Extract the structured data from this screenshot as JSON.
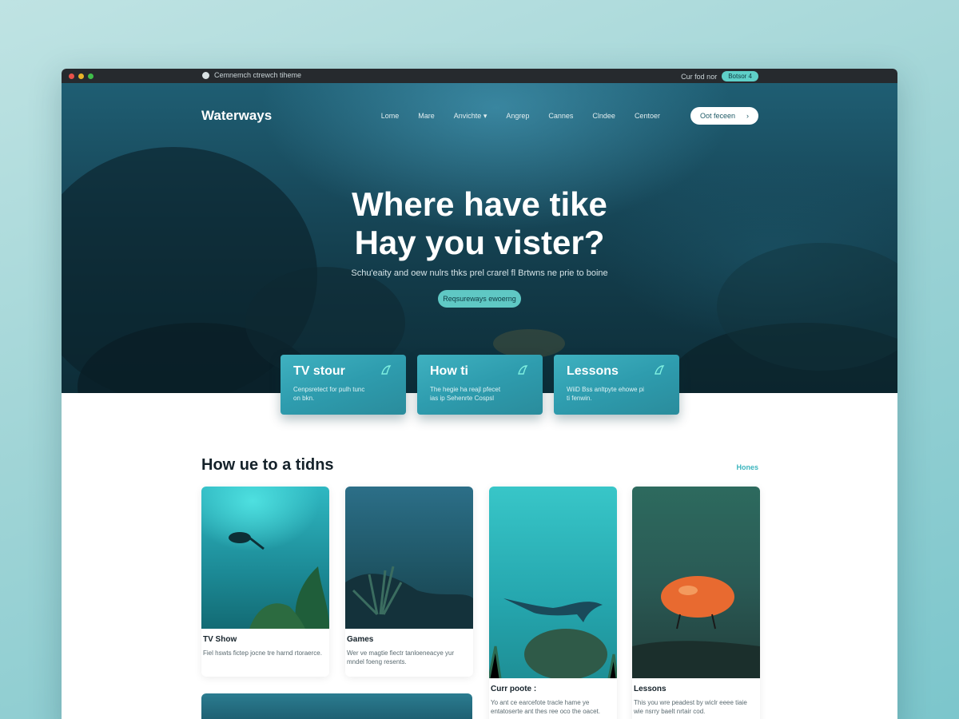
{
  "browser": {
    "url": "Cemnemch ctrewch tiheme",
    "right_link": "Cur fod nor",
    "right_button": "Botsor 4"
  },
  "nav": {
    "logo": "Waterways",
    "links": [
      "Lome",
      "Mare",
      "Anvichte ▾",
      "Angrep",
      "Cannes",
      "Clndee",
      "Centoer"
    ],
    "cta": "Oot feceen",
    "cta_icon": "›"
  },
  "hero": {
    "title_line1": "Where have tike",
    "title_line2": "Hay you vister?",
    "subtitle": "Schu'eaity and oew nulrs thks prel crarel fl Brtwns ne prie to boine",
    "button": "Reqsureways ewoerng"
  },
  "features": [
    {
      "title": "TV stour",
      "desc": "Cenpsretect for pulh tunc on bkn.",
      "icon": "fin-icon"
    },
    {
      "title": "How ti",
      "desc": "The hegie ha reajl pfecet ias ip Sehenrte Cospsl",
      "icon": "fin-icon"
    },
    {
      "title": "Lessons",
      "desc": "WiiD Bss anltpyte ehowe pi ti fenwin.",
      "icon": "fin-icon"
    }
  ],
  "section": {
    "title": "How ue to a tidns",
    "more": "Hones"
  },
  "cards": [
    {
      "title": "TV Show",
      "desc": "Fiel hswts fictep jocne tre harnd rtoraerce."
    },
    {
      "title": "Games",
      "desc": "Wer ve magtie fiectr tanloeneacye yur mndel foeng resents."
    },
    {
      "title": "Curr poote :",
      "desc": "Yo ant ce earcefote tracle hame ye entatoserte ant thes ree oco the oacet."
    },
    {
      "title": "Lessons",
      "desc": "This you wre peadest by wiclr eeee tiaie wie nsrry baelt nrtair cod."
    }
  ],
  "colors": {
    "accent": "#5fc8c4",
    "link": "#3bb5be",
    "hero_dark": "#123a48"
  }
}
